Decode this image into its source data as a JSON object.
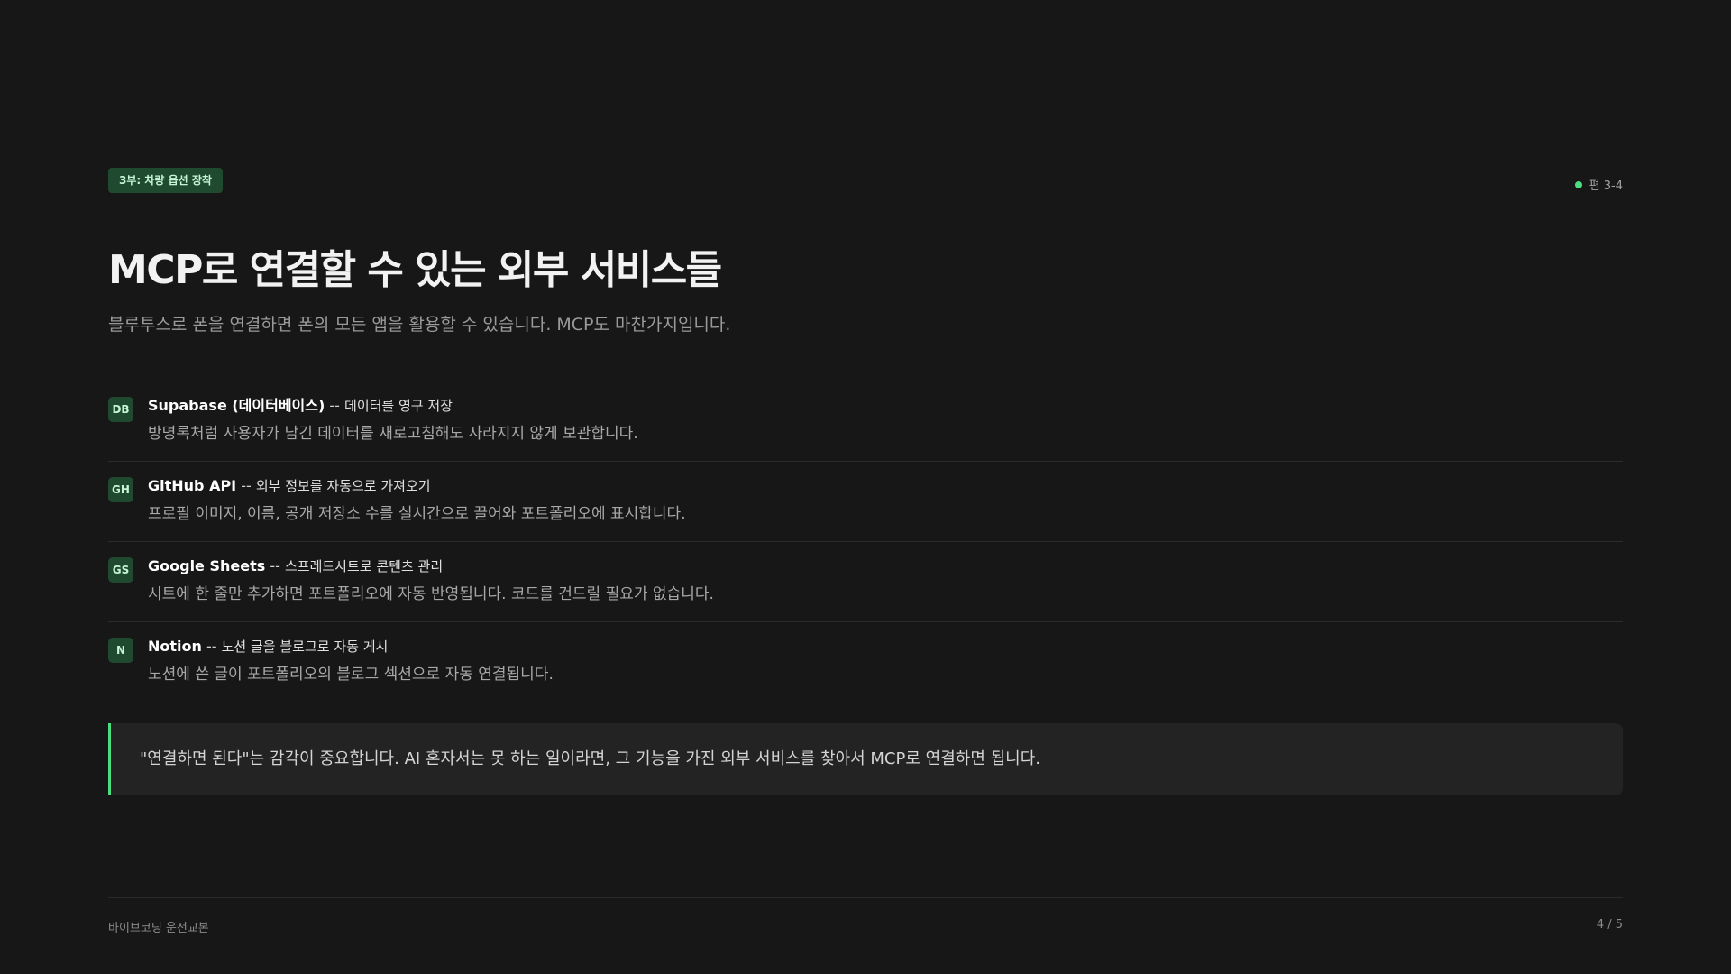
{
  "header": {
    "badge": "3부: 차량 옵션 장착",
    "episode": "편 3-4"
  },
  "title": "MCP로 연결할 수 있는 외부 서비스들",
  "subtitle": "블루투스로 폰을 연결하면 폰의 모든 앱을 활용할 수 있습니다. MCP도 마찬가지입니다.",
  "services": [
    {
      "icon": "DB",
      "name": "Supabase (데이터베이스)",
      "sep": " -- ",
      "tagline": "데이터를 영구 저장",
      "desc": "방명록처럼 사용자가 남긴 데이터를 새로고침해도 사라지지 않게 보관합니다."
    },
    {
      "icon": "GH",
      "name": "GitHub API",
      "sep": " -- ",
      "tagline": "외부 정보를 자동으로 가져오기",
      "desc": "프로필 이미지, 이름, 공개 저장소 수를 실시간으로 끌어와 포트폴리오에 표시합니다."
    },
    {
      "icon": "GS",
      "name": "Google Sheets",
      "sep": " -- ",
      "tagline": "스프레드시트로 콘텐츠 관리",
      "desc": "시트에 한 줄만 추가하면 포트폴리오에 자동 반영됩니다. 코드를 건드릴 필요가 없습니다."
    },
    {
      "icon": "N",
      "name": "Notion",
      "sep": " -- ",
      "tagline": "노션 글을 블로그로 자동 게시",
      "desc": "노션에 쓴 글이 포트폴리오의 블로그 섹션으로 자동 연결됩니다."
    }
  ],
  "quote": "\"연결하면 된다\"는 감각이 중요합니다. AI 혼자서는 못 하는 일이라면, 그 기능을 가진 외부 서비스를 찾아서 MCP로 연결하면 됩니다.",
  "footer": {
    "left": "바이브코딩 운전교본",
    "right": "4 / 5"
  },
  "colors": {
    "background": "#171717",
    "accent": "#4ade80",
    "badge_bg": "#1f4a2f"
  }
}
